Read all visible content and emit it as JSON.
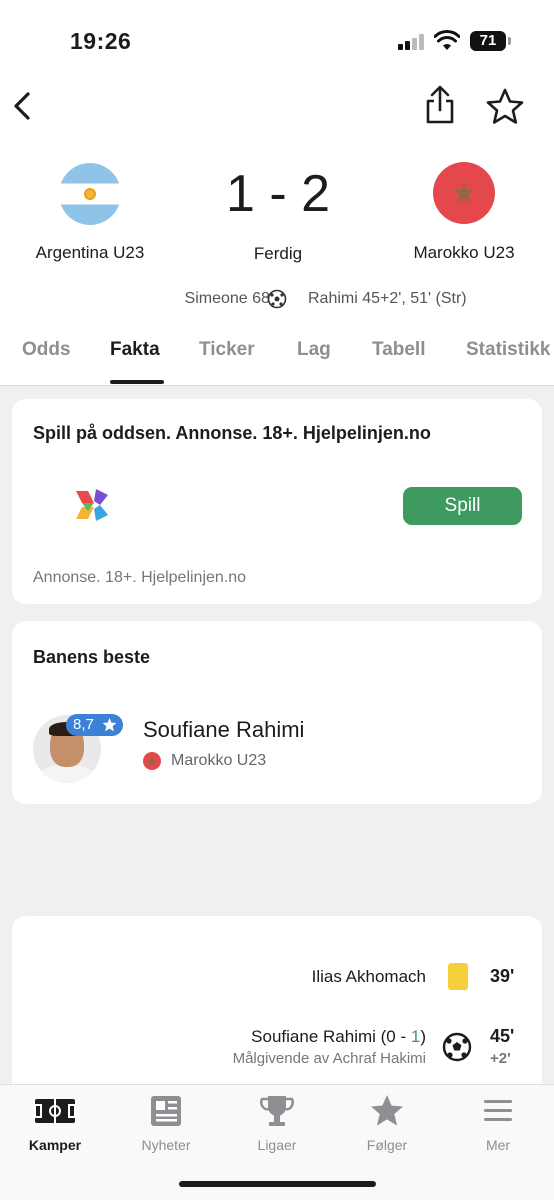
{
  "status_bar": {
    "time": "19:26",
    "battery": "71"
  },
  "match": {
    "home_team": "Argentina U23",
    "away_team": "Marokko U23",
    "score": "1 - 2",
    "status": "Ferdig",
    "home_scorers": "Simeone 68'",
    "away_scorers": "Rahimi 45+2', 51' (Str)"
  },
  "tabs": [
    {
      "label": "Odds"
    },
    {
      "label": "Fakta"
    },
    {
      "label": "Ticker"
    },
    {
      "label": "Lag"
    },
    {
      "label": "Tabell"
    },
    {
      "label": "Statistikk"
    }
  ],
  "active_tab": "Fakta",
  "ad": {
    "title": "Spill på oddsen. Annonse. 18+. Hjelpelinjen.no",
    "button_label": "Spill",
    "footer": "Annonse. 18+. Hjelpelinjen.no"
  },
  "best_player": {
    "section_title": "Banens beste",
    "rating": "8,7",
    "name": "Soufiane Rahimi",
    "team": "Marokko U23"
  },
  "events": [
    {
      "player": "Ilias Akhomach",
      "type": "yellow-card",
      "minute": "39'"
    },
    {
      "player": "Soufiane Rahimi (0 - ",
      "score_highlight": "1",
      "score_close": ")",
      "assist": "Målgivende av Achraf Hakimi",
      "type": "goal",
      "minute": "45'",
      "added_time": "+2'"
    }
  ],
  "bottom_nav": [
    {
      "label": "Kamper",
      "icon": "pitch-icon"
    },
    {
      "label": "Nyheter",
      "icon": "newspaper-icon"
    },
    {
      "label": "Ligaer",
      "icon": "trophy-icon"
    },
    {
      "label": "Følger",
      "icon": "star-icon"
    },
    {
      "label": "Mer",
      "icon": "menu-icon"
    }
  ],
  "colors": {
    "accent_green": "#3e9a5e",
    "rating_blue": "#3b82d6",
    "yellow_card": "#f5d03b",
    "morocco_red": "#e4484d"
  }
}
